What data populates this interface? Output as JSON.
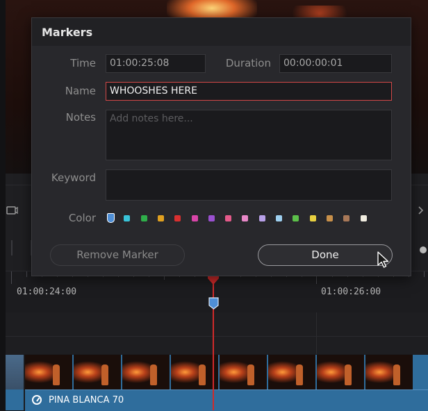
{
  "dialog": {
    "title": "Markers",
    "time_label": "Time",
    "time_value": "01:00:25:08",
    "duration_label": "Duration",
    "duration_value": "00:00:00:01",
    "name_label": "Name",
    "name_value": "WHOOSHES HERE",
    "notes_label": "Notes",
    "notes_placeholder": "Add notes here...",
    "keyword_label": "Keyword",
    "keyword_value": "",
    "color_label": "Color",
    "colors": [
      "#4f8fd6",
      "#39c3d8",
      "#2fae4a",
      "#e0a020",
      "#d83030",
      "#d845a8",
      "#9a50d0",
      "#e45a8a",
      "#e888c8",
      "#b8a0e8",
      "#9ed0f0",
      "#5cc04a",
      "#e8d040",
      "#c8904a",
      "#a87858",
      "#f0ece0"
    ],
    "selected_color": "#4f8fd6",
    "remove_label": "Remove Marker",
    "done_label": "Done"
  },
  "timeline": {
    "timecode_left": "01:00:24:00",
    "timecode_right": "01:00:26:00",
    "clip_name": "PINA BLANCA 70",
    "playhead_color": "#d22a2a",
    "clip_color": "#2f6d9c"
  }
}
